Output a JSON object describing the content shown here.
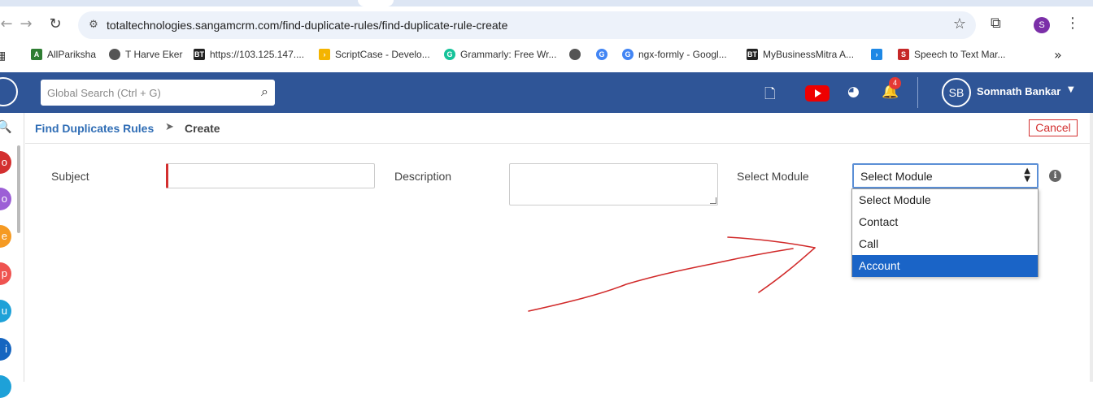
{
  "browser": {
    "url": "totaltechnologies.sangamcrm.com/find-duplicate-rules/find-duplicate-rule-create",
    "profile_initial": "S"
  },
  "bookmarks": [
    {
      "label": "AllPariksha",
      "icon": "allpariksha-icon",
      "color": "#2e7d32"
    },
    {
      "label": "T Harve Eker",
      "icon": "globe-icon",
      "color": "#555555"
    },
    {
      "label": "https://103.125.147....",
      "icon": "bt-icon",
      "color": "#222222"
    },
    {
      "label": "ScriptCase - Develo...",
      "icon": "scriptcase-icon",
      "color": "#f4b400"
    },
    {
      "label": "Grammarly: Free Wr...",
      "icon": "grammarly-icon",
      "color": "#15c39a"
    },
    {
      "label": "",
      "icon": "globe-icon",
      "color": "#555555"
    },
    {
      "label": "",
      "icon": "google-icon",
      "color": "#4285f4"
    },
    {
      "label": "ngx-formly - Googl...",
      "icon": "google-icon",
      "color": "#4285f4"
    },
    {
      "label": "MyBusinessMitra A...",
      "icon": "bt-icon",
      "color": "#222222"
    },
    {
      "label": "",
      "icon": "flutter-icon",
      "color": "#1e88e5"
    },
    {
      "label": "Speech to Text Mar...",
      "icon": "speech-icon",
      "color": "#c62828"
    }
  ],
  "header": {
    "search_placeholder": "Global Search (Ctrl + G)",
    "notification_count": "4",
    "avatar_initials": "SB",
    "user_name": "Somnath Bankar",
    "brand_color": "#2f5597"
  },
  "rail": {
    "letters": [
      {
        "letter": "o",
        "color": "#d32f2f"
      },
      {
        "letter": "o",
        "color": "#9c5fd6"
      },
      {
        "letter": "e",
        "color": "#f59a23"
      },
      {
        "letter": "p",
        "color": "#ef5350"
      },
      {
        "letter": "u",
        "color": "#1ea1d8"
      },
      {
        "letter": "i",
        "color": "#1565c0"
      }
    ]
  },
  "breadcrumb": {
    "parent": "Find Duplicates Rules",
    "current": "Create",
    "cancel_label": "Cancel"
  },
  "form": {
    "subject_label": "Subject",
    "subject_value": "",
    "description_label": "Description",
    "description_value": "",
    "module_label": "Select Module",
    "module_selected": "Select Module",
    "module_options": [
      "Select Module",
      "Contact",
      "Call",
      "Account"
    ],
    "highlighted_option": "Account"
  },
  "annotation": {
    "arrow_color": "#d12a2a"
  }
}
